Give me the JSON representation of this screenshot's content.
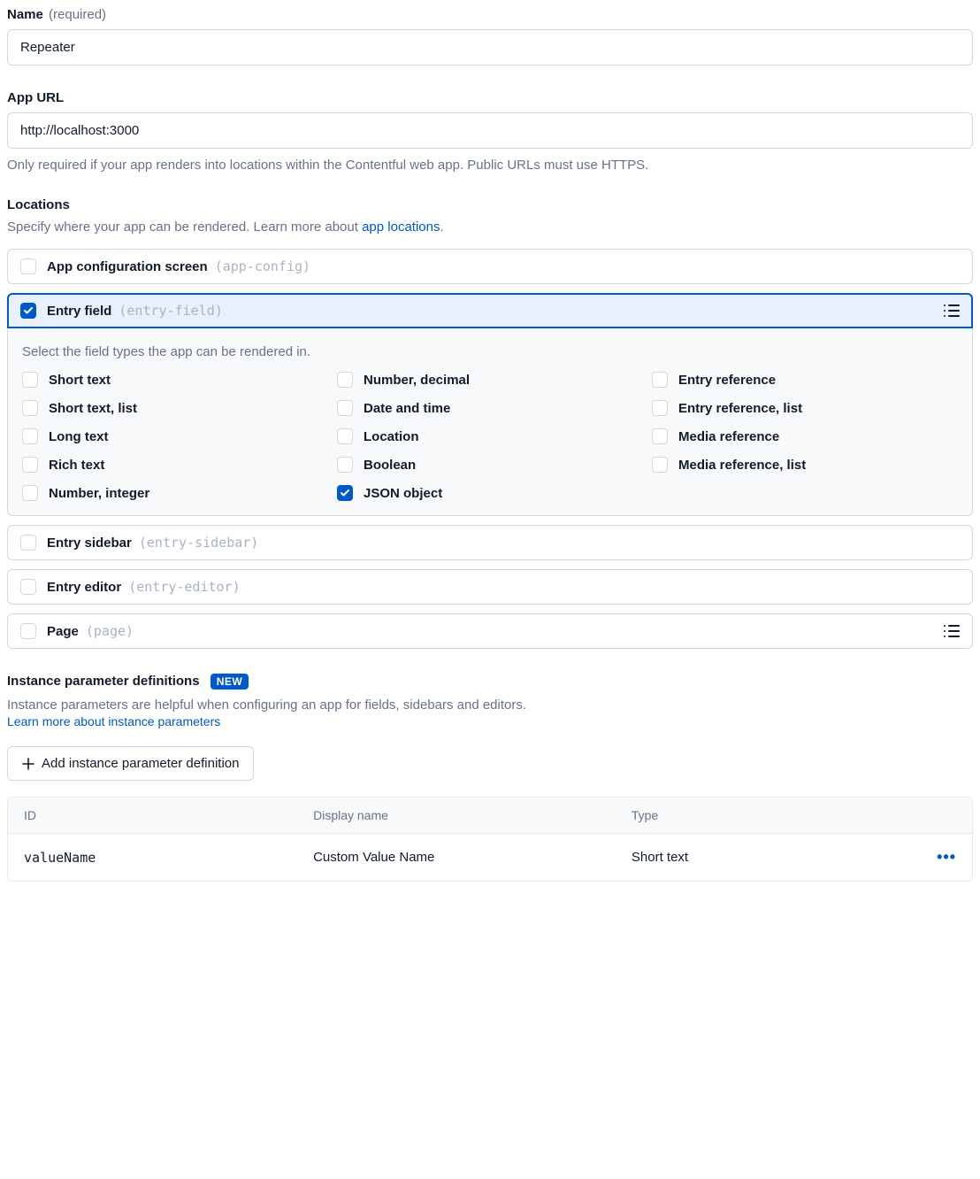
{
  "name": {
    "label": "Name",
    "required": "(required)",
    "value": "Repeater"
  },
  "appUrl": {
    "label": "App URL",
    "value": "http://localhost:3000",
    "helper": "Only required if your app renders into locations within the Contentful web app. Public URLs must use HTTPS."
  },
  "locations": {
    "label": "Locations",
    "desc_prefix": "Specify where your app can be rendered. Learn more about ",
    "link": "app locations",
    "desc_suffix": ".",
    "items": [
      {
        "label": "App configuration screen",
        "code": "(app-config)",
        "checked": false,
        "hasListIcon": false
      },
      {
        "label": "Entry field",
        "code": "(entry-field)",
        "checked": true,
        "hasListIcon": true
      },
      {
        "label": "Entry sidebar",
        "code": "(entry-sidebar)",
        "checked": false,
        "hasListIcon": false
      },
      {
        "label": "Entry editor",
        "code": "(entry-editor)",
        "checked": false,
        "hasListIcon": false
      },
      {
        "label": "Page",
        "code": "(page)",
        "checked": false,
        "hasListIcon": true
      }
    ]
  },
  "fieldTypes": {
    "helper": "Select the field types the app can be rendered in.",
    "items": [
      {
        "label": "Short text",
        "checked": false
      },
      {
        "label": "Number, decimal",
        "checked": false
      },
      {
        "label": "Entry reference",
        "checked": false
      },
      {
        "label": "Short text, list",
        "checked": false
      },
      {
        "label": "Date and time",
        "checked": false
      },
      {
        "label": "Entry reference, list",
        "checked": false
      },
      {
        "label": "Long text",
        "checked": false
      },
      {
        "label": "Location",
        "checked": false
      },
      {
        "label": "Media reference",
        "checked": false
      },
      {
        "label": "Rich text",
        "checked": false
      },
      {
        "label": "Boolean",
        "checked": false
      },
      {
        "label": "Media reference, list",
        "checked": false
      },
      {
        "label": "Number, integer",
        "checked": false
      },
      {
        "label": "JSON object",
        "checked": true
      }
    ]
  },
  "instanceParams": {
    "label": "Instance parameter definitions",
    "badge": "NEW",
    "desc": "Instance parameters are helpful when configuring an app for fields, sidebars and editors.",
    "link": "Learn more about instance parameters",
    "addButton": "Add instance parameter definition",
    "columns": {
      "id": "ID",
      "displayName": "Display name",
      "type": "Type"
    },
    "rows": [
      {
        "id": "valueName",
        "displayName": "Custom Value Name",
        "type": "Short text"
      }
    ]
  }
}
